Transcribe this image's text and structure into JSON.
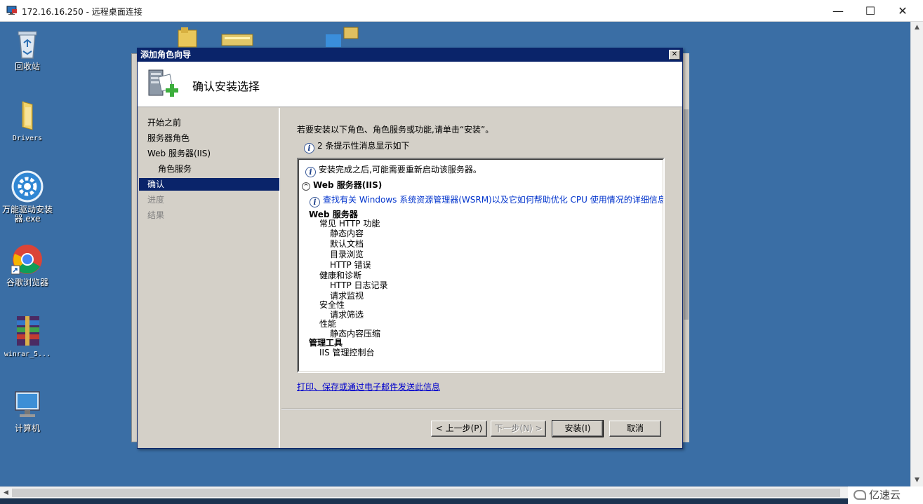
{
  "rdp_window": {
    "title": "172.16.16.250 - 远程桌面连接",
    "minimize": "—",
    "maximize": "☐",
    "close": "✕"
  },
  "desktop_icons": [
    {
      "label": "回收站",
      "icon": "recycle-bin-icon"
    },
    {
      "label": "Drivers",
      "icon": "folder-icon"
    },
    {
      "label": "万能驱动安装器.exe",
      "icon": "gear-app-icon"
    },
    {
      "label": "谷歌浏览器",
      "icon": "chrome-icon"
    },
    {
      "label": "winrar_5...",
      "icon": "winrar-icon"
    },
    {
      "label": "计算机",
      "icon": "computer-icon"
    }
  ],
  "dialog": {
    "title": "添加角色向导",
    "close": "✕",
    "header_title": "确认安装选择",
    "nav": [
      {
        "label": "开始之前",
        "state": "normal"
      },
      {
        "label": "服务器角色",
        "state": "normal"
      },
      {
        "label": "Web 服务器(IIS)",
        "state": "normal"
      },
      {
        "label": "角色服务",
        "state": "sub"
      },
      {
        "label": "确认",
        "state": "active"
      },
      {
        "label": "进度",
        "state": "disabled"
      },
      {
        "label": "结果",
        "state": "disabled"
      }
    ],
    "intro": "若要安装以下角色、角色服务或功能,请单击“安装”。",
    "info_count": "2 条提示性消息显示如下",
    "summary": {
      "restart_note": "安装完成之后,可能需要重新启动该服务器。",
      "role_heading": "Web 服务器(IIS)",
      "collapse": "^",
      "wsrm_link": "查找有关 Windows 系统资源管理器(WSRM)以及它如何帮助优化 CPU 使用情况的详细信息",
      "tree": [
        {
          "text": "Web 服务器",
          "level": 0,
          "bold": true
        },
        {
          "text": "常见 HTTP 功能",
          "level": 1
        },
        {
          "text": "静态内容",
          "level": 2
        },
        {
          "text": "默认文档",
          "level": 2
        },
        {
          "text": "目录浏览",
          "level": 2
        },
        {
          "text": "HTTP 错误",
          "level": 2
        },
        {
          "text": "健康和诊断",
          "level": 1
        },
        {
          "text": "HTTP 日志记录",
          "level": 2
        },
        {
          "text": "请求监视",
          "level": 2
        },
        {
          "text": "安全性",
          "level": 1
        },
        {
          "text": "请求筛选",
          "level": 2
        },
        {
          "text": "性能",
          "level": 1
        },
        {
          "text": "静态内容压缩",
          "level": 2
        },
        {
          "text": "管理工具",
          "level": 0,
          "bold": true
        },
        {
          "text": "IIS 管理控制台",
          "level": 1
        }
      ]
    },
    "email_link": "打印、保存或通过电子邮件发送此信息",
    "buttons": {
      "back": "< 上一步(P)",
      "next": "下一步(N) >",
      "install": "安装(I)",
      "cancel": "取消"
    }
  },
  "watermark": "亿速云",
  "colors": {
    "desktop": "#3a6ea5",
    "dialog_title": "#0a246a",
    "dialog_face": "#d4d0c8",
    "link": "#0033cc"
  }
}
